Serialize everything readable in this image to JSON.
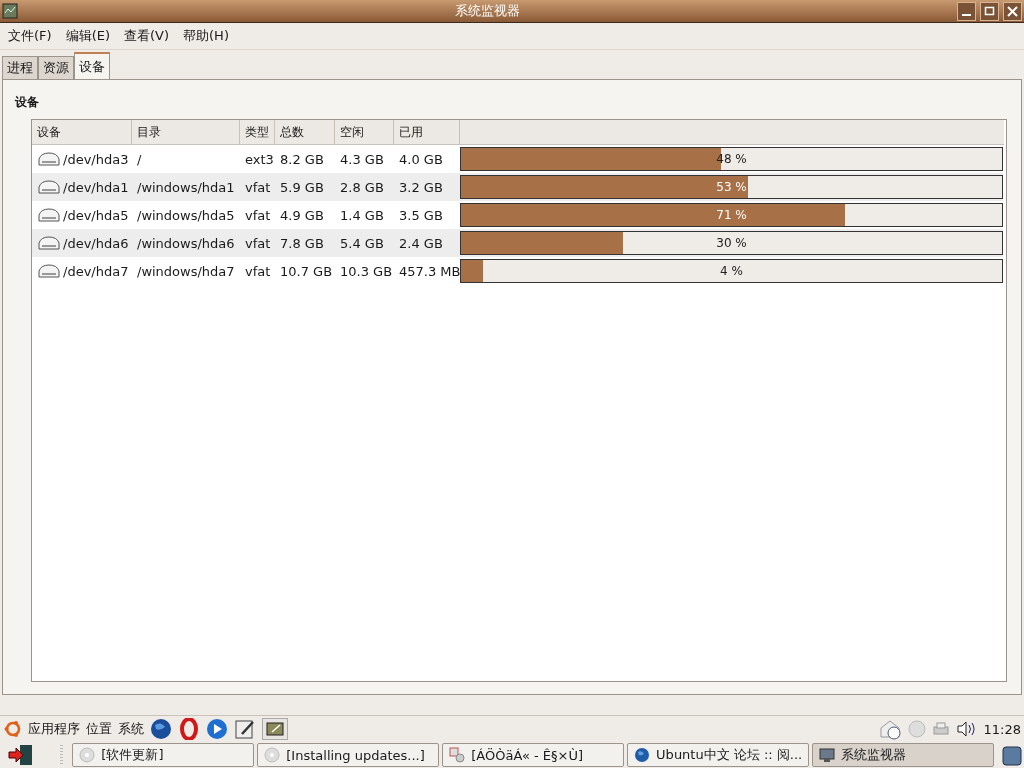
{
  "window": {
    "title": "系统监视器"
  },
  "menu": [
    "文件(F)",
    "编辑(E)",
    "查看(V)",
    "帮助(H)"
  ],
  "tabs": [
    {
      "label": "进程",
      "selected": false
    },
    {
      "label": "资源",
      "selected": false
    },
    {
      "label": "设备",
      "selected": true
    }
  ],
  "section_title": "设备",
  "table": {
    "columns": [
      "设备",
      "目录",
      "类型",
      "总数",
      "空闲",
      "已用"
    ],
    "rows": [
      {
        "device": "/dev/hda3",
        "directory": "/",
        "type": "ext3",
        "total": "8.2 GB",
        "free": "4.3 GB",
        "used": "4.0 GB",
        "level": 0.48,
        "reading": "48 %"
      },
      {
        "device": "/dev/hda1",
        "directory": "/windows/hda1",
        "type": "vfat",
        "total": "5.9 GB",
        "free": "2.8 GB",
        "used": "3.2 GB",
        "level": 0.53,
        "reading": "53 %"
      },
      {
        "device": "/dev/hda5",
        "directory": "/windows/hda5",
        "type": "vfat",
        "total": "4.9 GB",
        "free": "1.4 GB",
        "used": "3.5 GB",
        "level": 0.71,
        "reading": "71 %"
      },
      {
        "device": "/dev/hda6",
        "directory": "/windows/hda6",
        "type": "vfat",
        "total": "7.8 GB",
        "free": "5.4 GB",
        "used": "2.4 GB",
        "level": 0.3,
        "reading": "30 %"
      },
      {
        "device": "/dev/hda7",
        "directory": "/windows/hda7",
        "type": "vfat",
        "total": "10.7 GB",
        "free": "10.3 GB",
        "used": "457.3 MB",
        "level": 0.04,
        "reading": "4 %"
      }
    ]
  },
  "top_panel": {
    "menus": [
      "应用程序",
      "位置",
      "系统"
    ],
    "clock": "11:28"
  },
  "taskbar": [
    {
      "label": "[软件更新]",
      "kind": "disc",
      "selected": false
    },
    {
      "label": "[Installing updates...]",
      "kind": "disc",
      "selected": false
    },
    {
      "label": "[ÁÖÒäÁ« - Ê§×Ù]",
      "kind": "tool",
      "selected": false
    },
    {
      "label": "Ubuntu中文 论坛 :: 阅...",
      "kind": "globe",
      "selected": false
    },
    {
      "label": "系统监视器",
      "kind": "monitor",
      "selected": true
    }
  ]
}
